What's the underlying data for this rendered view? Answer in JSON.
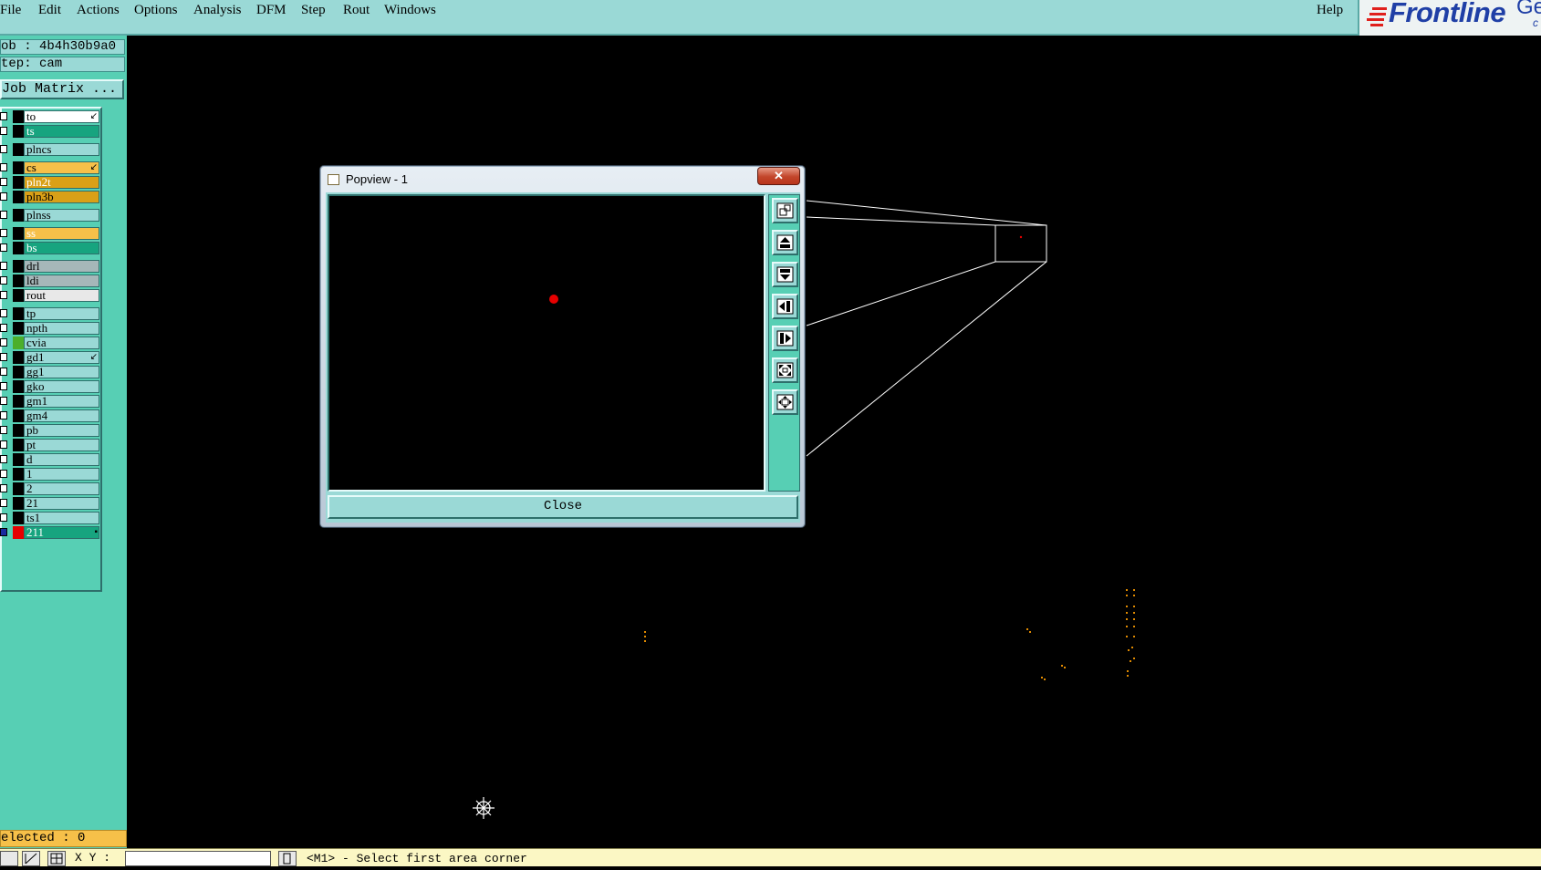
{
  "menubar": {
    "items": [
      "File",
      "Edit",
      "Actions",
      "Options",
      "Analysis",
      "DFM",
      "Step",
      "Rout",
      "Windows"
    ],
    "help": "Help",
    "logo_text": "Frontline",
    "logo_extra": "Ge",
    "logo_sub": "c"
  },
  "left_panel": {
    "job": "ob : 4b4h30b9a0",
    "step": "tep: cam",
    "job_matrix_button": "Job Matrix ...",
    "layers": [
      {
        "name": "to",
        "fill": "#ffffff",
        "swatch": "#000000",
        "mark": "↙",
        "text": "#000000"
      },
      {
        "name": "ts",
        "fill": "#17a47f",
        "swatch": "#000000",
        "mark": "",
        "text": "#ffffff"
      },
      {
        "name": "plncs",
        "fill": "#9ad9d6",
        "swatch": "#000000",
        "mark": "",
        "text": "#000000"
      },
      {
        "name": "cs",
        "fill": "#f6c049",
        "swatch": "#000000",
        "mark": "↙",
        "text": "#000000"
      },
      {
        "name": "pln2t",
        "fill": "#d9a017",
        "swatch": "#000000",
        "mark": "",
        "text": "#ffffff"
      },
      {
        "name": "pln3b",
        "fill": "#d9a017",
        "swatch": "#000000",
        "mark": "",
        "text": "#000000"
      },
      {
        "name": "plnss",
        "fill": "#9ad9d6",
        "swatch": "#000000",
        "mark": "",
        "text": "#000000"
      },
      {
        "name": "ss",
        "fill": "#f6c049",
        "swatch": "#000000",
        "mark": "",
        "text": "#ffffff"
      },
      {
        "name": "bs",
        "fill": "#17a47f",
        "swatch": "#000000",
        "mark": "",
        "text": "#ffffff"
      },
      {
        "name": "drl",
        "fill": "#a6b7b9",
        "swatch": "#000000",
        "mark": "",
        "text": "#000000"
      },
      {
        "name": "ldi",
        "fill": "#a6b7b9",
        "swatch": "#000000",
        "mark": "",
        "text": "#000000"
      },
      {
        "name": "rout",
        "fill": "#e8e8e8",
        "swatch": "#000000",
        "mark": "",
        "text": "#000000"
      },
      {
        "name": "tp",
        "fill": "#9ad9d6",
        "swatch": "#000000",
        "mark": "",
        "text": "#000000"
      },
      {
        "name": "npth",
        "fill": "#9ad9d6",
        "swatch": "#000000",
        "mark": "",
        "text": "#000000"
      },
      {
        "name": "cvia",
        "fill": "#9ad9d6",
        "swatch": "#4caf2a",
        "mark": "",
        "text": "#000000"
      },
      {
        "name": "gd1",
        "fill": "#9ad9d6",
        "swatch": "#000000",
        "mark": "↙",
        "text": "#000000"
      },
      {
        "name": "gg1",
        "fill": "#9ad9d6",
        "swatch": "#000000",
        "mark": "",
        "text": "#000000"
      },
      {
        "name": "gko",
        "fill": "#9ad9d6",
        "swatch": "#000000",
        "mark": "",
        "text": "#000000"
      },
      {
        "name": "gm1",
        "fill": "#9ad9d6",
        "swatch": "#000000",
        "mark": "",
        "text": "#000000"
      },
      {
        "name": "gm4",
        "fill": "#9ad9d6",
        "swatch": "#000000",
        "mark": "",
        "text": "#000000"
      },
      {
        "name": "pb",
        "fill": "#9ad9d6",
        "swatch": "#000000",
        "mark": "",
        "text": "#000000"
      },
      {
        "name": "pt",
        "fill": "#9ad9d6",
        "swatch": "#000000",
        "mark": "",
        "text": "#000000"
      },
      {
        "name": "d",
        "fill": "#9ad9d6",
        "swatch": "#000000",
        "mark": "",
        "text": "#000000"
      },
      {
        "name": "1",
        "fill": "#9ad9d6",
        "swatch": "#000000",
        "mark": "",
        "text": "#000000"
      },
      {
        "name": "2",
        "fill": "#9ad9d6",
        "swatch": "#000000",
        "mark": "",
        "text": "#000000"
      },
      {
        "name": "21",
        "fill": "#9ad9d6",
        "swatch": "#000000",
        "mark": "",
        "text": "#000000"
      },
      {
        "name": "ts1",
        "fill": "#9ad9d6",
        "swatch": "#000000",
        "mark": "",
        "text": "#000000"
      },
      {
        "name": "211",
        "fill": "#17a47f",
        "swatch": "#e60000",
        "mark": "▪",
        "text": "#ffffff"
      }
    ],
    "selected": "elected : 0"
  },
  "popview": {
    "title": "Popview - 1",
    "close_x": "✕",
    "close_button": "Close",
    "tools": [
      "zoom-home-icon",
      "pan-up-icon",
      "pan-down-icon",
      "pan-left-icon",
      "pan-right-icon",
      "zoom-out-icon",
      "zoom-in-icon"
    ]
  },
  "bottombar": {
    "xy_label": "X Y :",
    "xy_value": "",
    "status": "<M1> - Select first area corner"
  }
}
